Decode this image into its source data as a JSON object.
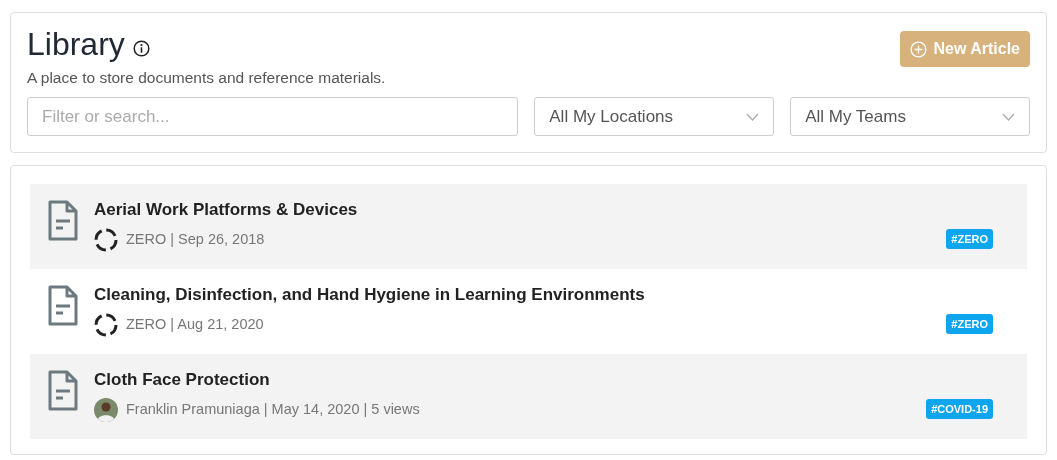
{
  "header": {
    "title": "Library",
    "subtitle": "A place to store documents and reference materials.",
    "new_button": "New Article"
  },
  "filters": {
    "search": {
      "placeholder": "Filter or search..."
    },
    "locations": "All My Locations",
    "teams": "All My Teams"
  },
  "articles": [
    {
      "title": "Aerial Work Platforms & Devices",
      "meta": "ZERO | Sep 26, 2018",
      "kind": "logo",
      "tag": "#ZERO",
      "shaded": true
    },
    {
      "title": "Cleaning, Disinfection, and Hand Hygiene in Learning Environments",
      "meta": "ZERO | Aug 21, 2020",
      "kind": "logo",
      "tag": "#ZERO",
      "shaded": false
    },
    {
      "title": "Cloth Face Protection",
      "meta": "Franklin Pramuniaga | May 14, 2020 | 5 views",
      "kind": "photo",
      "tag": "#COVID-19",
      "shaded": true
    }
  ]
}
